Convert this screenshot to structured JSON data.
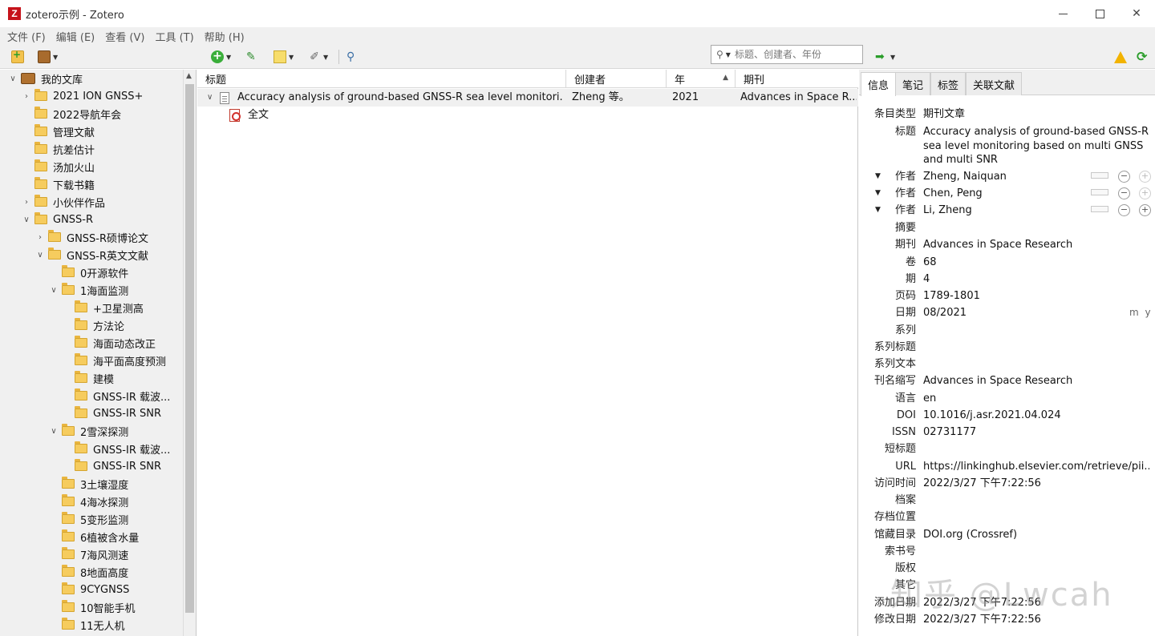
{
  "window": {
    "title": "zotero示例 - Zotero",
    "logo_letter": "Z"
  },
  "menubar": [
    "文件 (F)",
    "编辑 (E)",
    "查看 (V)",
    "工具 (T)",
    "帮助 (H)"
  ],
  "search": {
    "placeholder": "标题、创建者、年份"
  },
  "collections": [
    {
      "label": "我的文库",
      "level": 0,
      "twisty": "open",
      "icon": "library-icon"
    },
    {
      "label": "2021 ION GNSS+",
      "level": 1,
      "twisty": "closed",
      "icon": "folder-icon"
    },
    {
      "label": "2022导航年会",
      "level": 1,
      "twisty": "none",
      "icon": "folder-icon"
    },
    {
      "label": "管理文献",
      "level": 1,
      "twisty": "none",
      "icon": "folder-icon"
    },
    {
      "label": "抗差估计",
      "level": 1,
      "twisty": "none",
      "icon": "folder-icon"
    },
    {
      "label": "汤加火山",
      "level": 1,
      "twisty": "none",
      "icon": "folder-icon"
    },
    {
      "label": "下载书籍",
      "level": 1,
      "twisty": "none",
      "icon": "folder-icon"
    },
    {
      "label": "小伙伴作品",
      "level": 1,
      "twisty": "closed",
      "icon": "folder-icon"
    },
    {
      "label": "GNSS-R",
      "level": 1,
      "twisty": "open",
      "icon": "folder-icon"
    },
    {
      "label": "GNSS-R硕博论文",
      "level": 2,
      "twisty": "closed",
      "icon": "folder-icon"
    },
    {
      "label": "GNSS-R英文文献",
      "level": 2,
      "twisty": "open",
      "icon": "folder-icon"
    },
    {
      "label": "0开源软件",
      "level": 3,
      "twisty": "none",
      "icon": "folder-icon"
    },
    {
      "label": "1海面监测",
      "level": 3,
      "twisty": "open",
      "icon": "folder-icon"
    },
    {
      "label": "+卫星测高",
      "level": 4,
      "twisty": "none",
      "icon": "folder-icon"
    },
    {
      "label": "方法论",
      "level": 4,
      "twisty": "none",
      "icon": "folder-icon"
    },
    {
      "label": "海面动态改正",
      "level": 4,
      "twisty": "none",
      "icon": "folder-icon"
    },
    {
      "label": "海平面高度预测",
      "level": 4,
      "twisty": "none",
      "icon": "folder-icon"
    },
    {
      "label": "建模",
      "level": 4,
      "twisty": "none",
      "icon": "folder-icon"
    },
    {
      "label": "GNSS-IR 载波...",
      "level": 4,
      "twisty": "none",
      "icon": "folder-icon"
    },
    {
      "label": "GNSS-IR SNR",
      "level": 4,
      "twisty": "none",
      "icon": "folder-icon"
    },
    {
      "label": "2雪深探测",
      "level": 3,
      "twisty": "open",
      "icon": "folder-icon"
    },
    {
      "label": "GNSS-IR 载波...",
      "level": 4,
      "twisty": "none",
      "icon": "folder-icon"
    },
    {
      "label": "GNSS-IR SNR",
      "level": 4,
      "twisty": "none",
      "icon": "folder-icon"
    },
    {
      "label": "3土壤湿度",
      "level": 3,
      "twisty": "none",
      "icon": "folder-icon"
    },
    {
      "label": "4海冰探测",
      "level": 3,
      "twisty": "none",
      "icon": "folder-icon"
    },
    {
      "label": "5变形监测",
      "level": 3,
      "twisty": "none",
      "icon": "folder-icon"
    },
    {
      "label": "6植被含水量",
      "level": 3,
      "twisty": "none",
      "icon": "folder-icon"
    },
    {
      "label": "7海风测速",
      "level": 3,
      "twisty": "none",
      "icon": "folder-icon"
    },
    {
      "label": "8地面高度",
      "level": 3,
      "twisty": "none",
      "icon": "folder-icon"
    },
    {
      "label": "9CYGNSS",
      "level": 3,
      "twisty": "none",
      "icon": "folder-icon"
    },
    {
      "label": "10智能手机",
      "level": 3,
      "twisty": "none",
      "icon": "folder-icon"
    },
    {
      "label": "11无人机",
      "level": 3,
      "twisty": "none",
      "icon": "folder-icon"
    }
  ],
  "items_table": {
    "columns": {
      "title": "标题",
      "creator": "创建者",
      "year": "年",
      "journal": "期刊"
    },
    "rows": [
      {
        "title": "Accuracy analysis of ground-based GNSS-R sea level monitori...",
        "creator": "Zheng 等。",
        "year": "2021",
        "journal": "Advances in Space R...",
        "icon": "journal-article-icon"
      }
    ],
    "attachments": [
      {
        "title": "全文",
        "icon": "pdf-icon"
      }
    ]
  },
  "item_pane": {
    "tabs": [
      "信息",
      "笔记",
      "标签",
      "关联文献"
    ],
    "fields": {
      "item_type": {
        "label": "条目类型",
        "value": "期刊文章"
      },
      "title": {
        "label": "标题",
        "value": "Accuracy analysis of ground-based GNSS-R sea level monitoring based on multi GNSS and multi SNR"
      },
      "creators": [
        {
          "label": "作者",
          "value": "Zheng, Naiquan"
        },
        {
          "label": "作者",
          "value": "Chen, Peng"
        },
        {
          "label": "作者",
          "value": "Li, Zheng"
        }
      ],
      "abstract": {
        "label": "摘要",
        "value": ""
      },
      "publication": {
        "label": "期刊",
        "value": "Advances in Space Research"
      },
      "volume": {
        "label": "卷",
        "value": "68"
      },
      "issue": {
        "label": "期",
        "value": "4"
      },
      "pages": {
        "label": "页码",
        "value": "1789-1801"
      },
      "date": {
        "label": "日期",
        "value": "08/2021",
        "hint": "m y"
      },
      "series": {
        "label": "系列",
        "value": ""
      },
      "series_title": {
        "label": "系列标题",
        "value": ""
      },
      "series_text": {
        "label": "系列文本",
        "value": ""
      },
      "journal_abbr": {
        "label": "刊名缩写",
        "value": "Advances in Space Research"
      },
      "language": {
        "label": "语言",
        "value": "en"
      },
      "doi": {
        "label": "DOI",
        "value": "10.1016/j.asr.2021.04.024"
      },
      "issn": {
        "label": "ISSN",
        "value": "02731177"
      },
      "short_title": {
        "label": "短标题",
        "value": ""
      },
      "url": {
        "label": "URL",
        "value": "https://linkinghub.elsevier.com/retrieve/pii..."
      },
      "accessed": {
        "label": "访问时间",
        "value": "2022/3/27 下午7:22:56"
      },
      "archive": {
        "label": "档案",
        "value": ""
      },
      "archive_location": {
        "label": "存档位置",
        "value": ""
      },
      "library_catalog": {
        "label": "馆藏目录",
        "value": "DOI.org (Crossref)"
      },
      "call_number": {
        "label": "索书号",
        "value": ""
      },
      "rights": {
        "label": "版权",
        "value": ""
      },
      "extra": {
        "label": "其它",
        "value": ""
      },
      "date_added": {
        "label": "添加日期",
        "value": "2022/3/27 下午7:22:56"
      },
      "date_modified": {
        "label": "修改日期",
        "value": "2022/3/27 下午7:22:56"
      }
    }
  },
  "watermark": "知乎 @Lwcah",
  "colors": {
    "logo": "#c6131b",
    "folder": "#f6cc5e",
    "selected_row": "#f0f0f0",
    "chrome": "#f0f0f0"
  }
}
